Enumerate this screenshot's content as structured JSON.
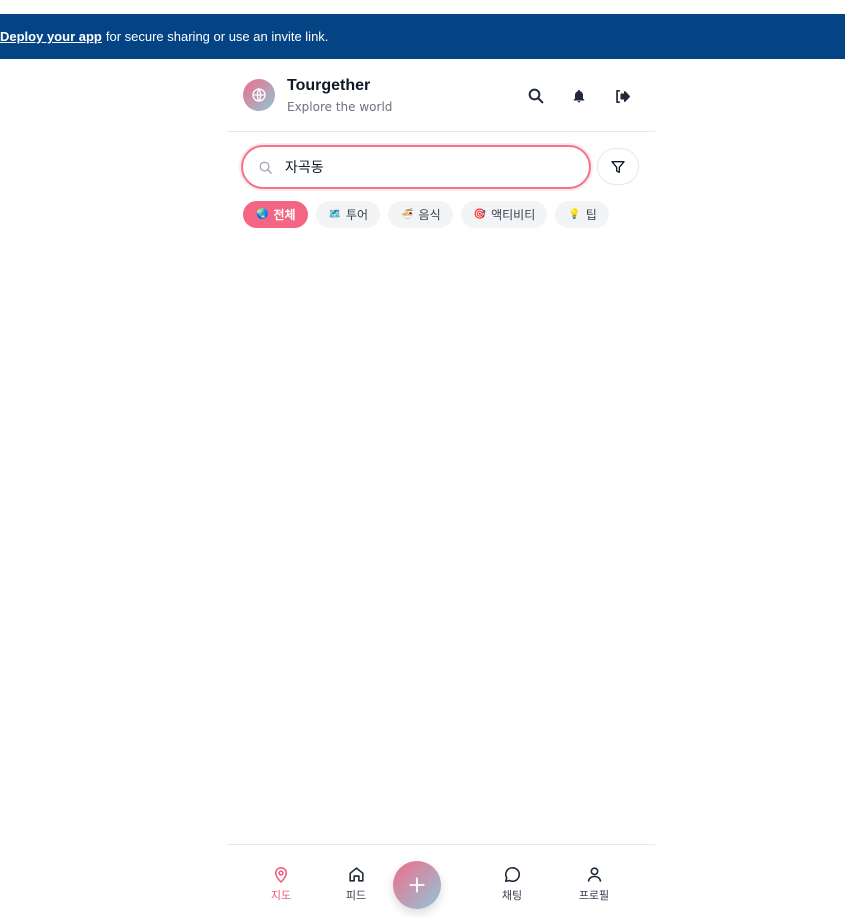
{
  "banner": {
    "link_text": "Deploy your app",
    "message": "for secure sharing or use an invite link."
  },
  "header": {
    "title": "Tourgether",
    "subtitle": "Explore the world"
  },
  "search": {
    "value": "자곡동"
  },
  "categories": [
    {
      "emoji": "🌏",
      "label": "전체",
      "active": true
    },
    {
      "emoji": "🗺️",
      "label": "투어"
    },
    {
      "emoji": "🍜",
      "label": "음식"
    },
    {
      "emoji": "🎯",
      "label": "액티비티"
    },
    {
      "emoji": "💡",
      "label": "팁"
    }
  ],
  "nav": {
    "map": "지도",
    "feed": "피드",
    "chat": "채팅",
    "profile": "프로필"
  },
  "colors": {
    "banner": "#044384",
    "accent": "#f46583",
    "brand_gradient_start": "#f06d8a",
    "brand_gradient_end": "#8fc6d8"
  }
}
